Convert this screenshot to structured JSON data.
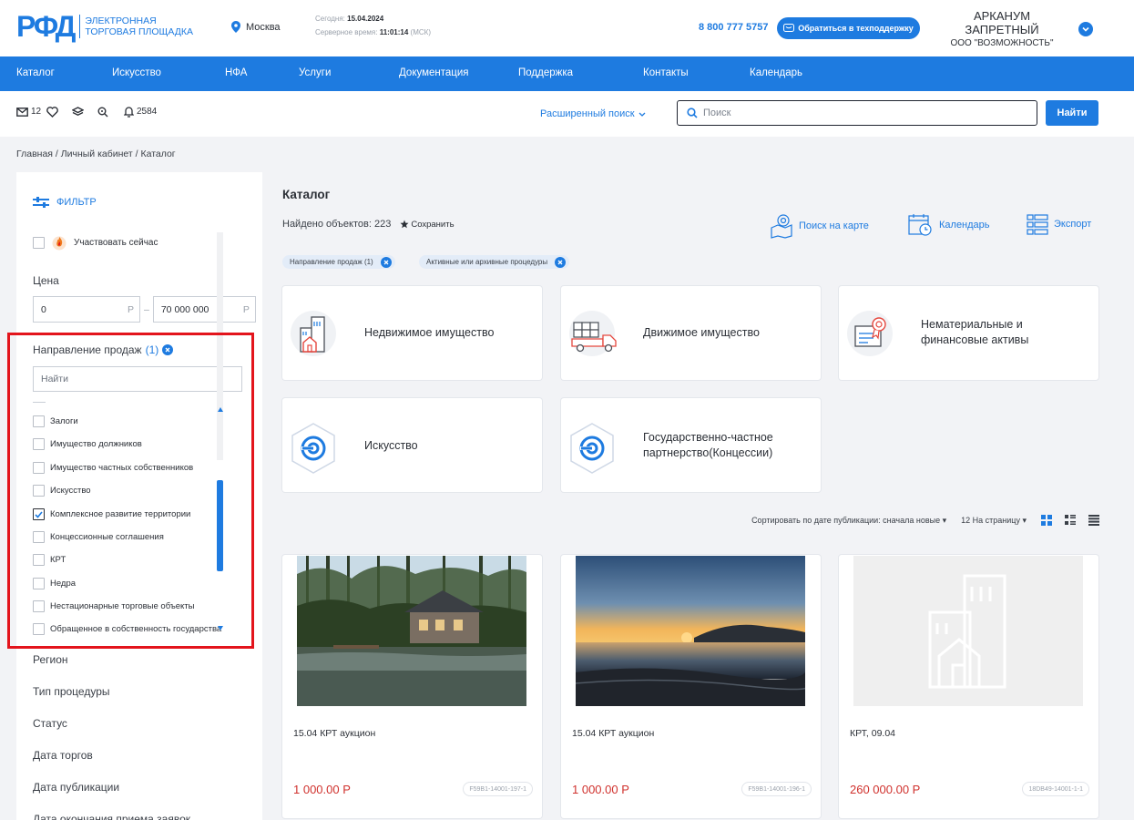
{
  "header": {
    "logo_mark": "РФД",
    "logo_line1": "Электронная",
    "logo_line2": "торговая площадка",
    "city": "Москва",
    "today_label": "Сегодня:",
    "today_value": "15.04.2024",
    "server_time_label": "Серверное время:",
    "server_time_value": "11:01:14",
    "timezone": "(МСК)",
    "phone": "8 800 777 5757",
    "support_label": "Обратиться в техподдержку",
    "user_name": "АРКАНУМ ЗАПРЕТНЫЙ",
    "user_org": "ООО \"ВОЗМОЖНОСТЬ\""
  },
  "nav": {
    "items": [
      "Каталог",
      "Искусство",
      "НФА",
      "Услуги",
      "Документация",
      "Поддержка",
      "Контакты",
      "Календарь"
    ]
  },
  "toolbar": {
    "messages_count": "12",
    "notifications_count": "2584",
    "advanced_search_label": "Расширенный поиск",
    "search_placeholder": "Поиск",
    "find_label": "Найти"
  },
  "breadcrumb": "Главная  /  Личный кабинет  /  Каталог",
  "filter": {
    "title": "Фильтр",
    "participate_label": "Участвовать сейчас",
    "price_label": "Цена",
    "price_from": "0",
    "price_to": "70 000 000",
    "currency": "Р",
    "direction_label": "Направление продаж",
    "direction_count": "(1)",
    "direction_search_placeholder": "Найти",
    "direction_items": [
      {
        "label": "Залоги",
        "checked": false
      },
      {
        "label": "Имущество должников",
        "checked": false
      },
      {
        "label": "Имущество частных собственников",
        "checked": false
      },
      {
        "label": "Искусство",
        "checked": false
      },
      {
        "label": "Комплексное развитие территории",
        "checked": true
      },
      {
        "label": "Концессионные соглашения",
        "checked": false
      },
      {
        "label": "КРТ",
        "checked": false
      },
      {
        "label": "Недра",
        "checked": false
      },
      {
        "label": "Нестационарные торговые объекты",
        "checked": false
      },
      {
        "label": "Обращенное в собственность государства",
        "checked": false
      }
    ],
    "sections": [
      "Регион",
      "Тип процедуры",
      "Статус",
      "Дата торгов",
      "Дата публикации",
      "Дата окончания приема заявок"
    ]
  },
  "catalog": {
    "title": "Каталог",
    "found_label": "Найдено объектов: 223",
    "save_label": "Сохранить",
    "map_search_label": "Поиск на карте",
    "calendar_label": "Календарь",
    "export_label": "Экспорт",
    "chips": [
      "Направление продаж (1)",
      "Активные или архивные процедуры"
    ],
    "categories": [
      {
        "name": "Недвижимое имущество"
      },
      {
        "name": "Движимое имущество"
      },
      {
        "name_line1": "Нематериальные и",
        "name_line2": "финансовые активы"
      },
      {
        "name": "Искусство"
      },
      {
        "name_line1": "Государственно-частное",
        "name_line2": "партнерство(Концессии)"
      }
    ],
    "sort_label": "Сортировать по дате публикации: сначала новые",
    "per_page_label": "12 На страницу"
  },
  "products": [
    {
      "title": "15.04 КРТ аукцион",
      "price": "1 000.00 Р",
      "code": "F59B1-14001-197-1"
    },
    {
      "title": "15.04 КРТ аукцион",
      "price": "1 000.00 Р",
      "code": "F59B1-14001-196-1"
    },
    {
      "title": "КРТ, 09.04",
      "price": "260 000.00 Р",
      "code": "18DB49-14001-1-1"
    }
  ],
  "colors": {
    "accent": "#1e7be0",
    "price": "#d0312d",
    "highlight_frame": "#e3141c"
  }
}
